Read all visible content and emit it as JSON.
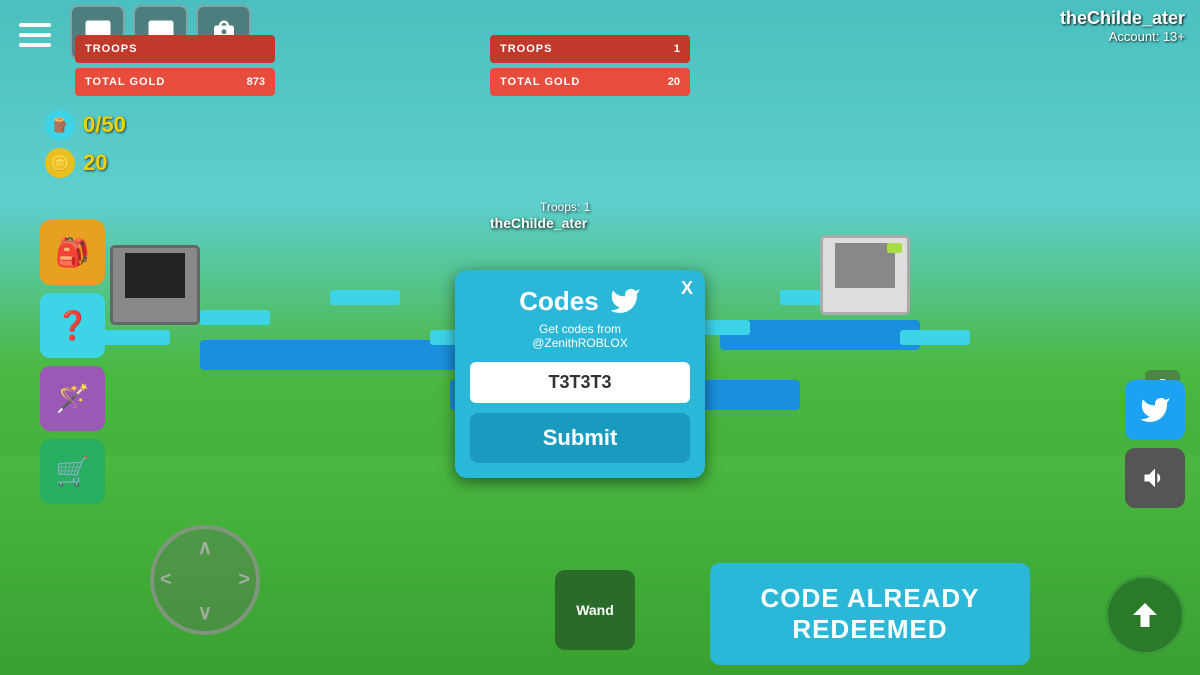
{
  "game": {
    "background_color": "#4bbfcf"
  },
  "hud": {
    "troops_label": "TROOPS",
    "troops_value_left": "",
    "troops_value_right": "1",
    "gold_label": "TOTAL GOLD",
    "gold_value_left": "873",
    "gold_value_right": "20"
  },
  "resources": {
    "wood_value": "0/50",
    "gold_value": "20"
  },
  "player": {
    "username": "theChilde_ater",
    "account": "Account: 13+",
    "label_in_game": "theChilde_ater",
    "troops_label": "Troops: 1"
  },
  "codes_modal": {
    "title": "Codes",
    "close_label": "X",
    "subtitle_line1": "Get codes from",
    "subtitle_line2": "@ZenithROBLOX",
    "input_value": "T3T3T3",
    "submit_label": "Submit"
  },
  "redeemed_banner": {
    "line1": "CODE ALREADY",
    "line2": "REDEEMED"
  },
  "wand_button": {
    "label": "Wand"
  },
  "icons": {
    "hamburger": "☰",
    "chat1": "💬",
    "chat2": "💬",
    "bag": "🎒",
    "wood": "🪵",
    "coin": "🪙",
    "shop": "🛒",
    "magic": "🪄",
    "question": "?",
    "up_arrow": "↑",
    "twitter_bird": "🐦",
    "volume": "🔊"
  },
  "side_buttons": [
    {
      "id": "bag-btn",
      "color": "#e8a020",
      "icon": "🎒"
    },
    {
      "id": "question-side-btn",
      "color": "#3dd4e8",
      "icon": "❓"
    },
    {
      "id": "wand-side-btn",
      "color": "#9b59b6",
      "icon": "🪄"
    },
    {
      "id": "cart-side-btn",
      "color": "#27ae60",
      "icon": "🛒"
    }
  ]
}
